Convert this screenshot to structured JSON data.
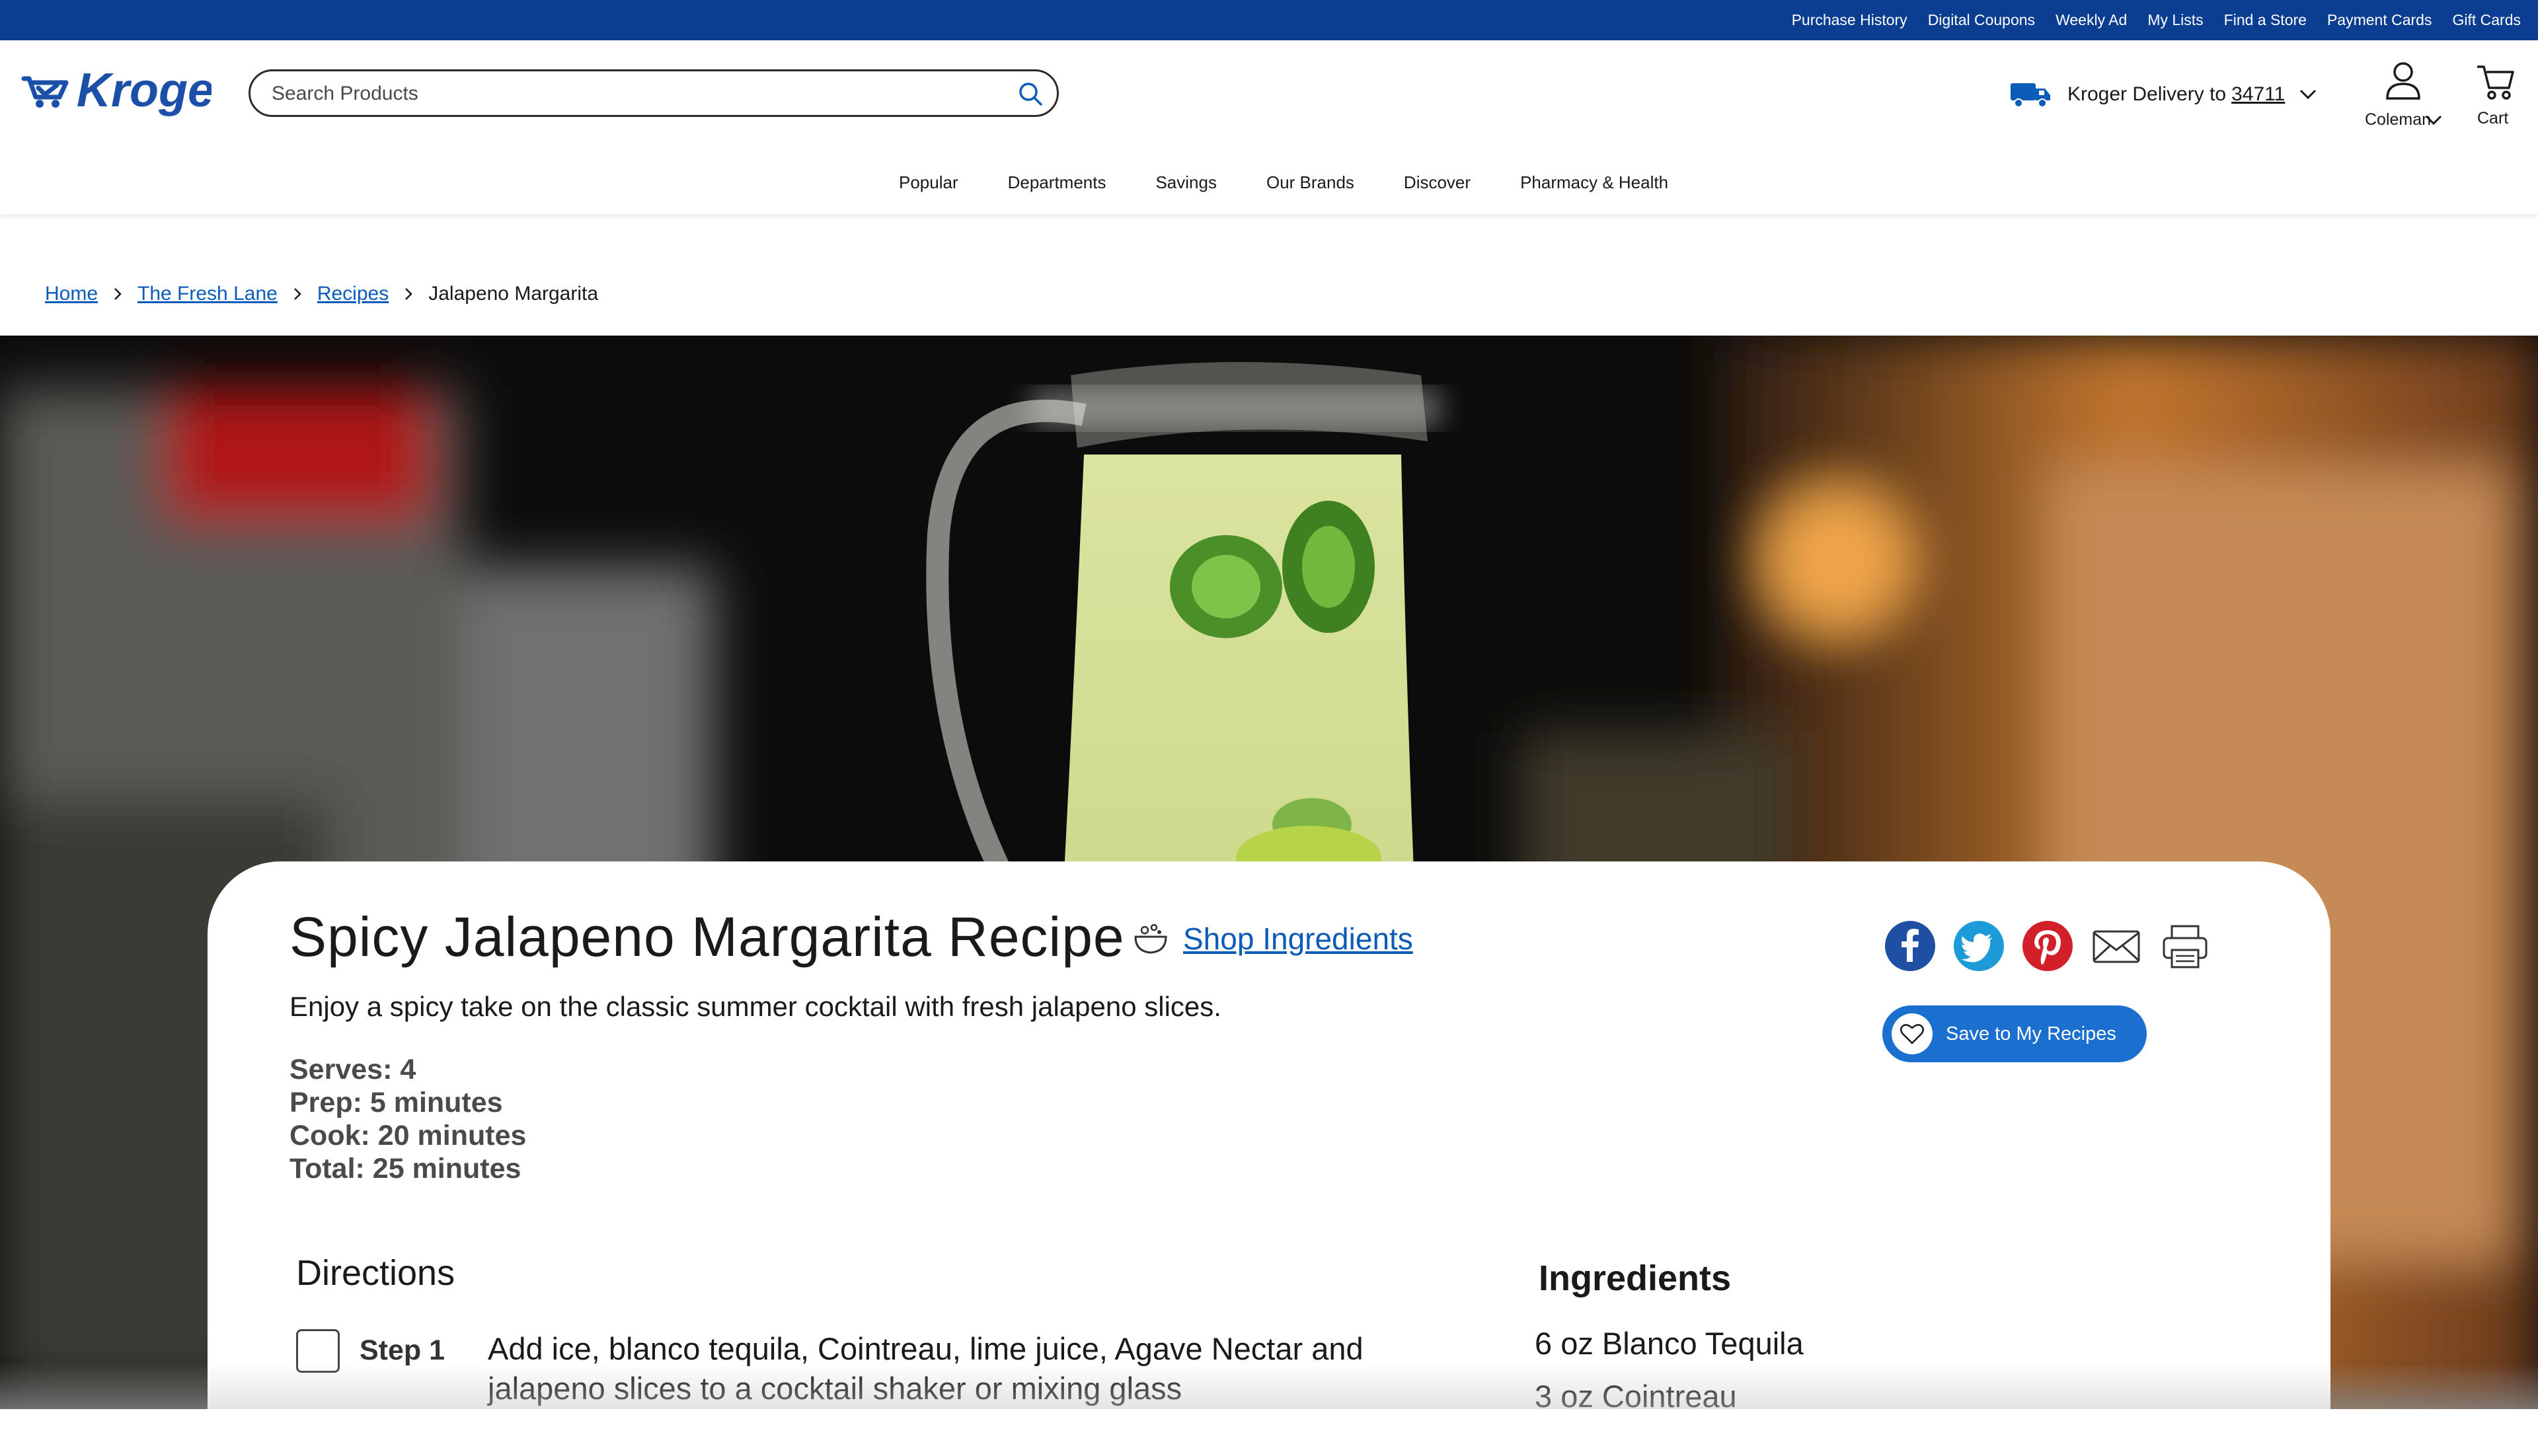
{
  "utility": {
    "links": [
      "Purchase History",
      "Digital Coupons",
      "Weekly Ad",
      "My Lists",
      "Find a Store",
      "Payment Cards",
      "Gift Cards"
    ]
  },
  "header": {
    "logo_text": "Kroger",
    "search_placeholder": "Search Products",
    "delivery_label": "Kroger Delivery to",
    "delivery_zip": "34711",
    "account_label": "Coleman",
    "cart_label": "Cart"
  },
  "nav": {
    "items": [
      "Popular",
      "Departments",
      "Savings",
      "Our Brands",
      "Discover",
      "Pharmacy & Health"
    ]
  },
  "breadcrumb": {
    "links": [
      "Home",
      "The Fresh Lane",
      "Recipes"
    ],
    "current": "Jalapeno Margarita"
  },
  "recipe": {
    "title": "Spicy Jalapeno Margarita Recipe",
    "shop_label": "Shop Ingredients",
    "description": "Enjoy a spicy take on the classic summer cocktail with fresh jalapeno slices.",
    "serves": "Serves: 4",
    "prep": "Prep: 5 minutes",
    "cook": "Cook: 20 minutes",
    "total": "Total: 25 minutes",
    "save_label": "Save to My Recipes"
  },
  "directions": {
    "heading": "Directions",
    "steps": [
      {
        "label": "Step 1",
        "text": "Add ice, blanco tequila, Cointreau, lime juice, Agave Nectar and jalapeno slices to a cocktail shaker or mixing glass"
      }
    ]
  },
  "ingredients": {
    "heading": "Ingredients",
    "items": [
      "6 oz Blanco Tequila",
      "3 oz Cointreau"
    ]
  },
  "colors": {
    "brand_blue": "#0b3d91",
    "link_blue": "#0b5cb8",
    "facebook": "#1e4fa3",
    "twitter": "#1d9bd8",
    "pinterest": "#d21f29",
    "save_button": "#1b6fcf"
  },
  "icons": {
    "search": "search-icon",
    "truck": "truck-icon",
    "account": "user-icon",
    "cart": "cart-icon",
    "bowl": "bowl-icon",
    "heart": "heart-icon"
  }
}
